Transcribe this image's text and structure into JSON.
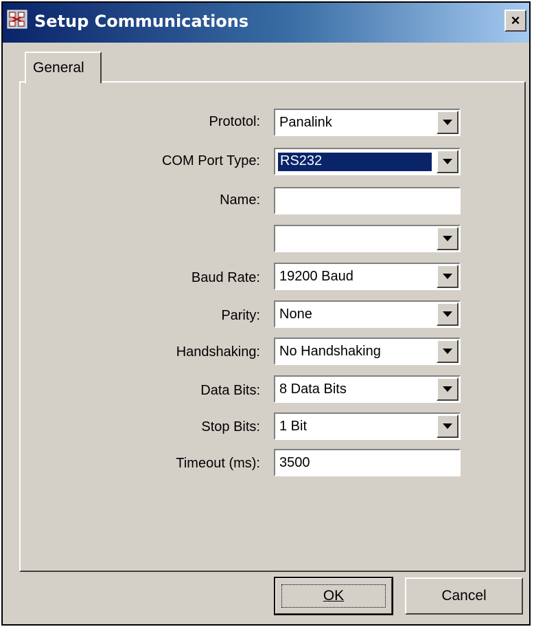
{
  "window": {
    "title": "Setup Communications",
    "close_label": "×"
  },
  "tabs": [
    {
      "label": "General"
    }
  ],
  "fields": {
    "protocol": {
      "label": "Prototol:",
      "value": "Panalink"
    },
    "com_port_type": {
      "label": "COM Port Type:",
      "value": "RS232"
    },
    "name": {
      "label": "Name:",
      "value": ""
    },
    "port": {
      "label": "",
      "value": ""
    },
    "baud_rate": {
      "label": "Baud Rate:",
      "value": "19200 Baud"
    },
    "parity": {
      "label": "Parity:",
      "value": "None"
    },
    "handshaking": {
      "label": "Handshaking:",
      "value": "No Handshaking"
    },
    "data_bits": {
      "label": "Data Bits:",
      "value": "8 Data Bits"
    },
    "stop_bits": {
      "label": "Stop Bits:",
      "value": "1 Bit"
    },
    "timeout": {
      "label": "Timeout (ms):",
      "value": "3500"
    }
  },
  "buttons": {
    "ok": "OK",
    "cancel": "Cancel"
  },
  "colors": {
    "titlebar_start": "#0a246a",
    "titlebar_end": "#a6caf0",
    "dialog_face": "#d4d0c8",
    "selection": "#0a246a"
  }
}
